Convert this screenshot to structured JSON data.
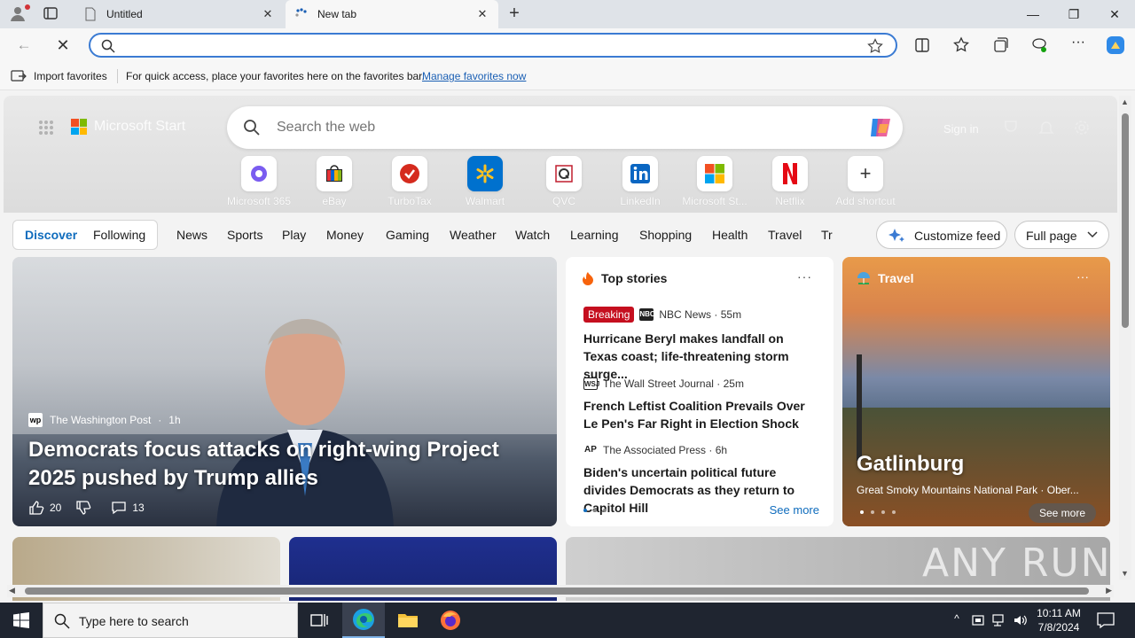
{
  "browser": {
    "tabs": [
      {
        "label": "Untitled",
        "active": false
      },
      {
        "label": "New tab",
        "active": true
      }
    ],
    "address": {
      "value": "",
      "placeholder": ""
    },
    "favorites_bar": {
      "import_label": "Import favorites",
      "message": "For quick access, place your favorites here on the favorites bar.",
      "link": "Manage favorites now"
    }
  },
  "start": {
    "brand": "Microsoft Start",
    "search_placeholder": "Search the web",
    "signin": "Sign in",
    "shortcuts": [
      {
        "label": "Microsoft 365",
        "icon": "microsoft-365-icon"
      },
      {
        "label": "eBay",
        "icon": "ebay-icon"
      },
      {
        "label": "TurboTax",
        "icon": "turbotax-icon"
      },
      {
        "label": "Walmart",
        "icon": "walmart-icon"
      },
      {
        "label": "QVC",
        "icon": "qvc-icon"
      },
      {
        "label": "LinkedIn",
        "icon": "linkedin-icon"
      },
      {
        "label": "Microsoft St...",
        "icon": "microsoft-store-icon"
      },
      {
        "label": "Netflix",
        "icon": "netflix-icon"
      },
      {
        "label": "Add shortcut",
        "icon": "plus-icon"
      }
    ]
  },
  "feed_nav": {
    "discover": "Discover",
    "following": "Following",
    "items": [
      "News",
      "Sports",
      "Play",
      "Money",
      "Gaming",
      "Weather",
      "Watch",
      "Learning",
      "Shopping",
      "Health",
      "Travel",
      "Tr"
    ],
    "customize": "Customize feed",
    "layout": "Full page"
  },
  "main_story": {
    "source": "The Washington Post",
    "age": "1h",
    "title": "Democrats focus attacks on right-wing Project 2025 pushed by Trump allies",
    "likes": "20",
    "comments": "13"
  },
  "top_stories": {
    "heading": "Top stories",
    "breaking_label": "Breaking",
    "stories": [
      {
        "source": "NBC News · 55m",
        "headline": "Hurricane Beryl makes landfall on Texas coast; life-threatening storm surge..."
      },
      {
        "source": "The Wall Street Journal · 25m",
        "headline": "French Leftist Coalition Prevails Over Le Pen's Far Right in Election Shock"
      },
      {
        "source": "The Associated Press · 6h",
        "headline": "Biden's uncertain political future divides Democrats as they return to Capitol Hill"
      }
    ],
    "see_more": "See more"
  },
  "travel": {
    "heading": "Travel",
    "title": "Gatlinburg",
    "subtitle": "Great Smoky Mountains National Park · Ober...",
    "see_more": "See more"
  },
  "watermark": "ANY RUN",
  "taskbar": {
    "search_placeholder": "Type here to search",
    "time": "10:11 AM",
    "date": "7/8/2024"
  },
  "colors": {
    "accent": "#0f6cbd",
    "breaking": "#c50f1f",
    "address_border": "#3b7bd3"
  }
}
